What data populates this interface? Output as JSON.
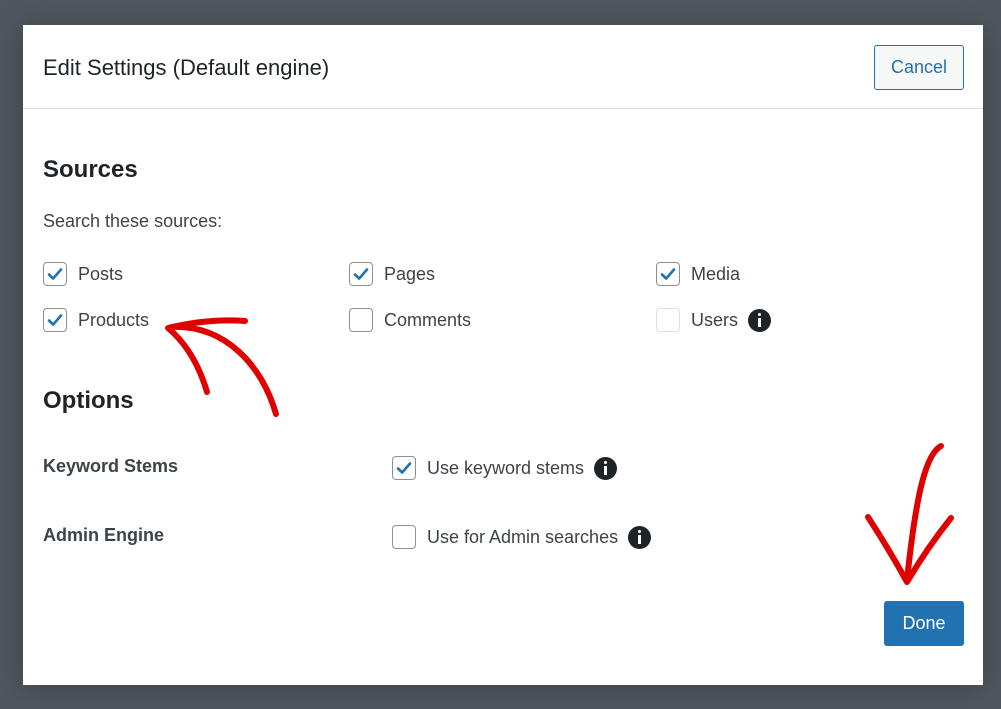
{
  "modal": {
    "title": "Edit Settings (Default engine)",
    "cancel_label": "Cancel",
    "done_label": "Done"
  },
  "sources": {
    "title": "Sources",
    "description": "Search these sources:",
    "items": [
      {
        "label": "Posts",
        "checked": true
      },
      {
        "label": "Pages",
        "checked": true
      },
      {
        "label": "Media",
        "checked": true
      },
      {
        "label": "Products",
        "checked": true
      },
      {
        "label": "Comments",
        "checked": false
      },
      {
        "label": "Users",
        "checked": false,
        "disabled": true,
        "info": true
      }
    ]
  },
  "options": {
    "title": "Options",
    "keyword_stems": {
      "label": "Keyword Stems",
      "checkbox_label": "Use keyword stems",
      "checked": true
    },
    "admin_engine": {
      "label": "Admin Engine",
      "checkbox_label": "Use for Admin searches",
      "checked": false
    }
  },
  "colors": {
    "accent": "#2271b1",
    "annotation": "#e00000",
    "backdrop": "#50575e"
  }
}
